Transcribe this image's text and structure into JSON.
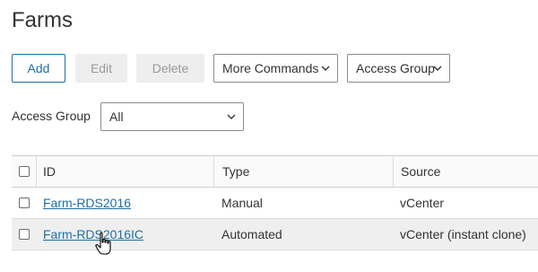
{
  "page": {
    "title": "Farms"
  },
  "toolbar": {
    "add_label": "Add",
    "edit_label": "Edit",
    "delete_label": "Delete",
    "more_commands_label": "More Commands",
    "access_group_label": "Access Group"
  },
  "filter": {
    "label": "Access Group",
    "selected": "All"
  },
  "table": {
    "columns": [
      "ID",
      "Type",
      "Source"
    ],
    "rows": [
      {
        "id": "Farm-RDS2016",
        "type": "Manual",
        "source": "vCenter"
      },
      {
        "id": "Farm-RDS2016IC",
        "type": "Automated",
        "source": "vCenter (instant clone)"
      }
    ]
  },
  "colors": {
    "accent": "#1d6fa5",
    "disabled_bg": "#eeeeee",
    "row_hover": "#efefef"
  },
  "icons": [
    "chevron-down-icon",
    "hand-pointer-cursor-icon"
  ]
}
